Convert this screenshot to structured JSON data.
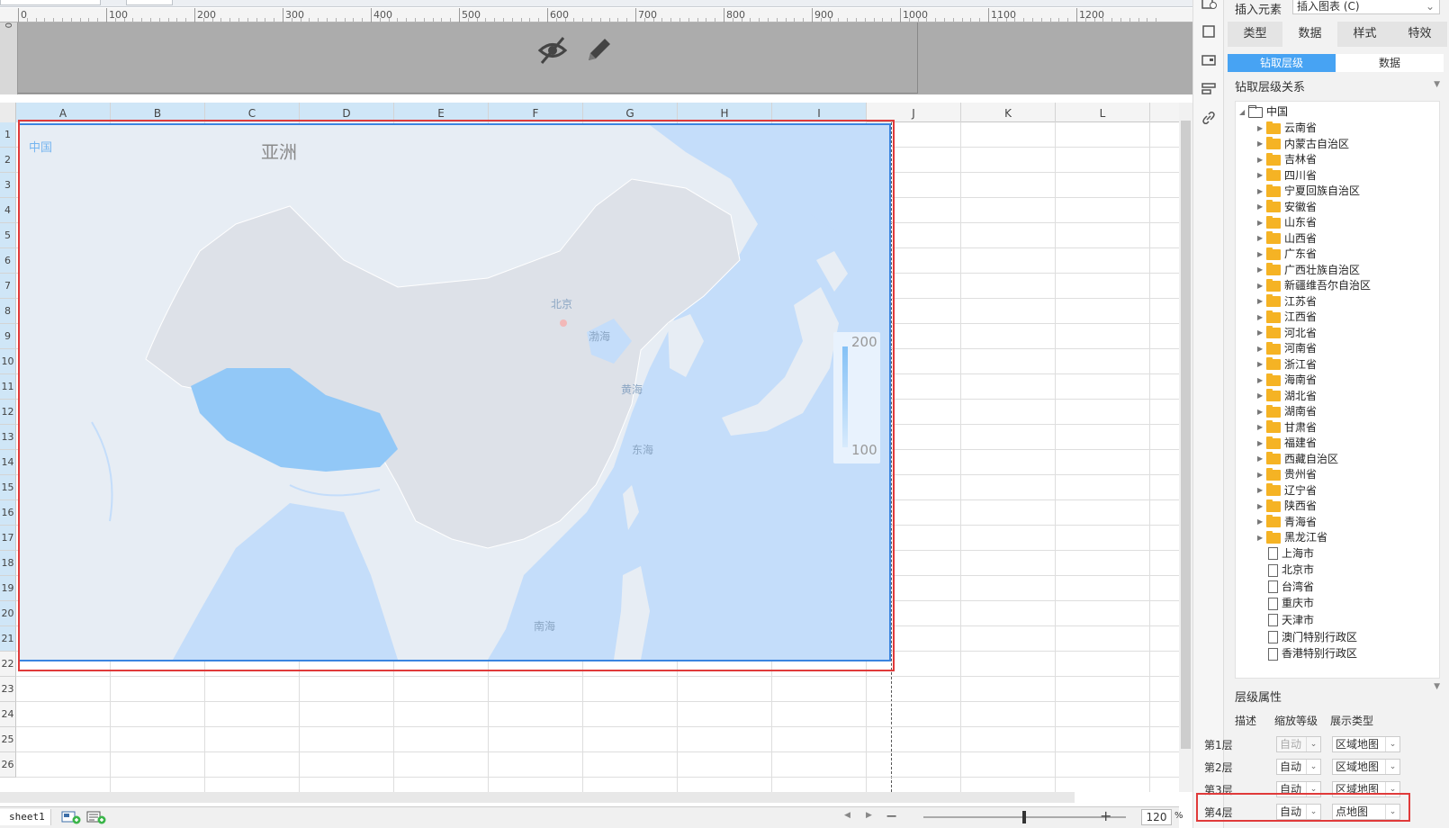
{
  "ruler": {
    "labels": [
      "0",
      "100",
      "200",
      "300",
      "400",
      "500",
      "600",
      "700",
      "800",
      "900",
      "1000",
      "1100",
      "1200"
    ],
    "side_label": "0"
  },
  "columns": [
    "A",
    "B",
    "C",
    "D",
    "E",
    "F",
    "G",
    "H",
    "I",
    "J",
    "K",
    "L"
  ],
  "rows": [
    "1",
    "2",
    "3",
    "4",
    "5",
    "6",
    "7",
    "8",
    "9",
    "10",
    "11",
    "12",
    "13",
    "14",
    "15",
    "16",
    "17",
    "18",
    "19",
    "20",
    "21",
    "22",
    "23",
    "24",
    "25",
    "26"
  ],
  "map": {
    "breadcrumb": "中国",
    "title": "亚洲",
    "sea_labels": {
      "bohai": "渤海",
      "huanghai": "黄海",
      "donghai": "东海",
      "nanhai": "南海"
    },
    "capital": "北京",
    "legend": {
      "max": "200",
      "min": "100"
    },
    "colors": {
      "water": "#c4ddfa",
      "land": "#e7edf4",
      "china": "#dde1e8",
      "highlight": "#92c8f7",
      "selection": "#3a84e0",
      "annotation": "#e03a3a"
    }
  },
  "bottom": {
    "sheet_tab": "sheet1",
    "zoom": "120",
    "zoom_unit": "%",
    "zoom_minus": "−",
    "zoom_plus": "+"
  },
  "panel": {
    "insert_label": "插入元素",
    "insert_select": "插入图表 (C)",
    "tabs": [
      "类型",
      "数据",
      "样式",
      "特效"
    ],
    "active_tab": "数据",
    "subtabs": [
      "钻取层级",
      "数据"
    ],
    "drill_title": "钻取层级关系",
    "tree_root": "中国",
    "tree_folders": [
      "云南省",
      "内蒙古自治区",
      "吉林省",
      "四川省",
      "宁夏回族自治区",
      "安徽省",
      "山东省",
      "山西省",
      "广东省",
      "广西壮族自治区",
      "新疆维吾尔自治区",
      "江苏省",
      "江西省",
      "河北省",
      "河南省",
      "浙江省",
      "海南省",
      "湖北省",
      "湖南省",
      "甘肃省",
      "福建省",
      "西藏自治区",
      "贵州省",
      "辽宁省",
      "陕西省",
      "青海省",
      "黑龙江省"
    ],
    "tree_files": [
      "上海市",
      "北京市",
      "台湾省",
      "重庆市",
      "天津市",
      "澳门特别行政区",
      "香港特别行政区"
    ],
    "props_title": "层级属性",
    "props_headers": [
      "描述",
      "缩放等级",
      "展示类型"
    ],
    "levels": [
      {
        "desc": "第1层",
        "zoom": "自动",
        "type": "区域地图"
      },
      {
        "desc": "第2层",
        "zoom": "自动",
        "type": "区域地图"
      },
      {
        "desc": "第3层",
        "zoom": "自动",
        "type": "区域地图"
      },
      {
        "desc": "第4层",
        "zoom": "自动",
        "type": "点地图"
      }
    ]
  }
}
